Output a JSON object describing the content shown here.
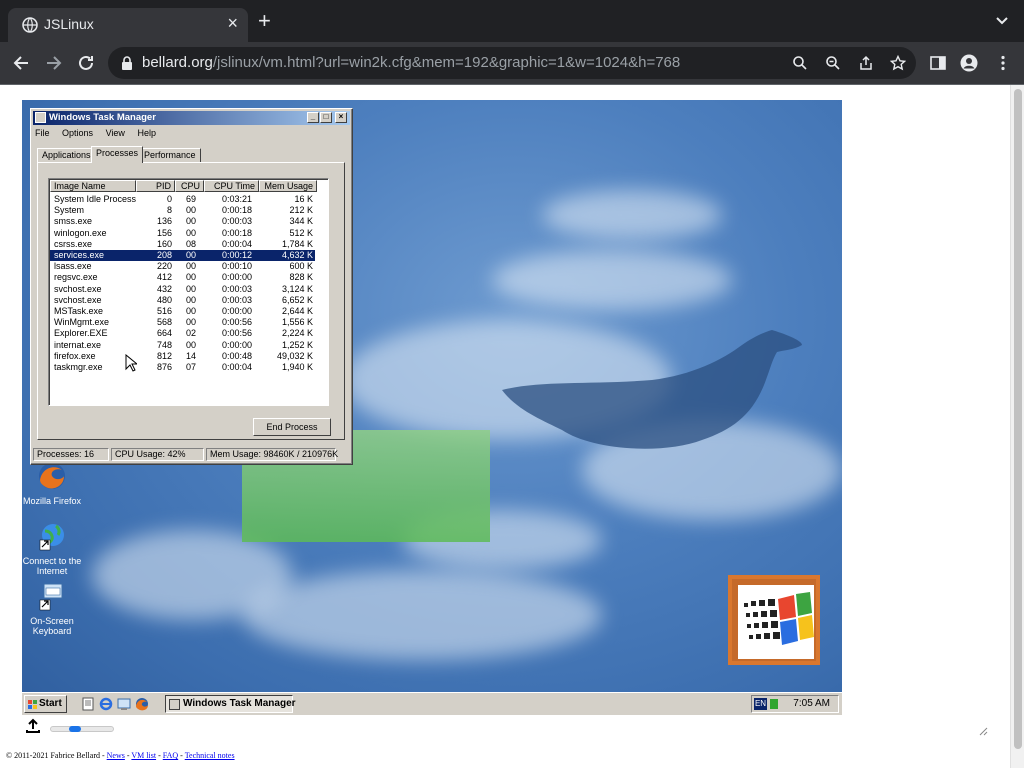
{
  "browser": {
    "tab_title": "JSLinux",
    "url_host": "bellard.org",
    "url_path": "/jslinux/vm.html?url=win2k.cfg&mem=192&graphic=1&w=1024&h=768",
    "icons": [
      "globe-icon",
      "close-icon",
      "plus-icon",
      "chevron-down-icon",
      "back-icon",
      "forward-icon",
      "reload-icon",
      "lock-icon",
      "search-icon",
      "zoom-out-icon",
      "share-icon",
      "star-icon",
      "sidepanel-icon",
      "profile-icon",
      "more-icon"
    ]
  },
  "desktop": {
    "icons": [
      {
        "label": "Mozilla Firefox"
      },
      {
        "label": "Connect to the Internet"
      },
      {
        "label": "On-Screen Keyboard"
      }
    ]
  },
  "task_manager": {
    "title": "Windows Task Manager",
    "menu": [
      "File",
      "Options",
      "View",
      "Help"
    ],
    "tabs": [
      "Applications",
      "Processes",
      "Performance"
    ],
    "active_tab": "Processes",
    "columns": [
      "Image Name",
      "PID",
      "CPU",
      "CPU Time",
      "Mem Usage"
    ],
    "rows": [
      {
        "name": "System Idle Process",
        "pid": "0",
        "cpu": "69",
        "time": "0:03:21",
        "mem": "16 K"
      },
      {
        "name": "System",
        "pid": "8",
        "cpu": "00",
        "time": "0:00:18",
        "mem": "212 K"
      },
      {
        "name": "smss.exe",
        "pid": "136",
        "cpu": "00",
        "time": "0:00:03",
        "mem": "344 K"
      },
      {
        "name": "winlogon.exe",
        "pid": "156",
        "cpu": "00",
        "time": "0:00:18",
        "mem": "512 K"
      },
      {
        "name": "csrss.exe",
        "pid": "160",
        "cpu": "08",
        "time": "0:00:04",
        "mem": "1,784 K"
      },
      {
        "name": "services.exe",
        "pid": "208",
        "cpu": "00",
        "time": "0:00:12",
        "mem": "4,632 K"
      },
      {
        "name": "lsass.exe",
        "pid": "220",
        "cpu": "00",
        "time": "0:00:10",
        "mem": "600 K"
      },
      {
        "name": "regsvc.exe",
        "pid": "412",
        "cpu": "00",
        "time": "0:00:00",
        "mem": "828 K"
      },
      {
        "name": "svchost.exe",
        "pid": "432",
        "cpu": "00",
        "time": "0:00:03",
        "mem": "3,124 K"
      },
      {
        "name": "svchost.exe",
        "pid": "480",
        "cpu": "00",
        "time": "0:00:03",
        "mem": "6,652 K"
      },
      {
        "name": "MSTask.exe",
        "pid": "516",
        "cpu": "00",
        "time": "0:00:00",
        "mem": "2,644 K"
      },
      {
        "name": "WinMgmt.exe",
        "pid": "568",
        "cpu": "00",
        "time": "0:00:56",
        "mem": "1,556 K"
      },
      {
        "name": "Explorer.EXE",
        "pid": "664",
        "cpu": "02",
        "time": "0:00:56",
        "mem": "2,224 K"
      },
      {
        "name": "internat.exe",
        "pid": "748",
        "cpu": "00",
        "time": "0:00:00",
        "mem": "1,252 K"
      },
      {
        "name": "firefox.exe",
        "pid": "812",
        "cpu": "14",
        "time": "0:00:48",
        "mem": "49,032 K"
      },
      {
        "name": "taskmgr.exe",
        "pid": "876",
        "cpu": "07",
        "time": "0:00:04",
        "mem": "1,940 K"
      }
    ],
    "selected_row": "services.exe",
    "end_process_label": "End Process",
    "status": {
      "processes": "Processes: 16",
      "cpu": "CPU Usage: 42%",
      "mem": "Mem Usage: 98460K / 210976K"
    }
  },
  "taskbar": {
    "start_label": "Start",
    "task_button": "Windows Task Manager",
    "lang": "EN",
    "clock": "7:05 AM"
  },
  "page": {
    "upload_icon": "upload-icon",
    "slider_fraction": 0.35,
    "footer_prefix": "© 2011-2021 Fabrice Bellard - ",
    "footer_links": [
      "News",
      "VM list",
      "FAQ",
      "Technical notes"
    ]
  },
  "colors": {
    "chrome_dark": "#202124",
    "chrome_toolbar": "#35363a",
    "win_face": "#d4d0c8",
    "win_title": "#0a246a",
    "selection": "#0a246a"
  }
}
